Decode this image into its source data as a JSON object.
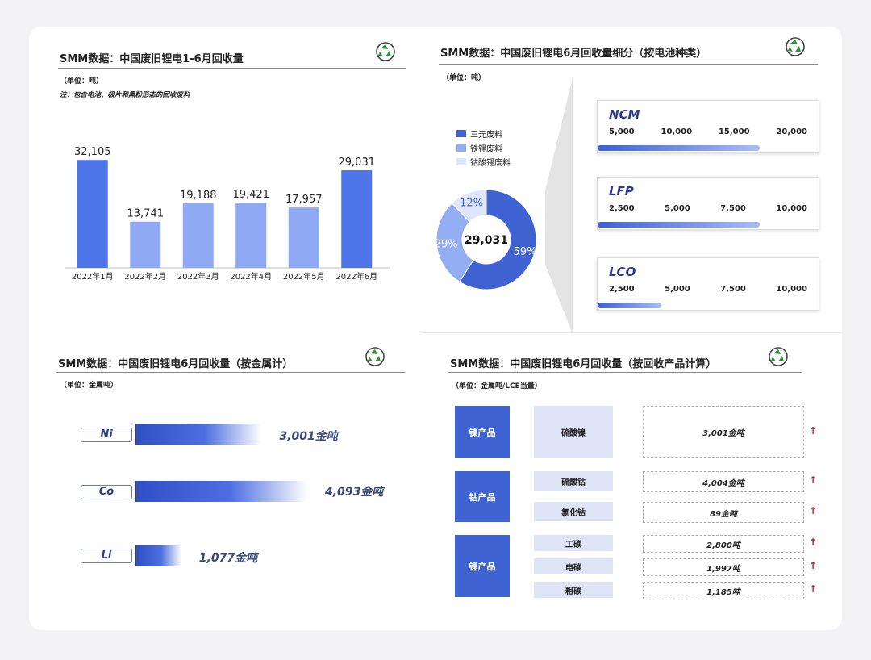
{
  "colors": {
    "accent": "#6f8ff0",
    "deep_blue": "#3f63d3",
    "mid_blue": "#93aef3",
    "light_blue": "#dfe6fb",
    "arrow_red": "#c0202a"
  },
  "panel1": {
    "title": "SMM数据：中国废旧锂电1-6月回收量",
    "unit": "（单位：吨）",
    "note": "注：包含电池、极片和黑粉形态的回收废料",
    "icon": "recycle-icon"
  },
  "panel2": {
    "title": "SMM数据：中国废旧锂电6月回收量细分（按电池种类）",
    "unit": "（单位：吨）",
    "icon": "recycle-icon",
    "center_total": "29,031",
    "legend": [
      "三元废料",
      "铁锂废料",
      "钴酸锂废料"
    ],
    "types": [
      {
        "name": "NCM",
        "ticks": [
          "5,000",
          "10,000",
          "15,000",
          "20,000"
        ],
        "level": 0.74
      },
      {
        "name": "LFP",
        "ticks": [
          "2,500",
          "5,000",
          "7,500",
          "10,000"
        ],
        "level": 0.74
      },
      {
        "name": "LCO",
        "ticks": [
          "2,500",
          "5,000",
          "7,500",
          "10,000"
        ],
        "level": 0.29
      }
    ]
  },
  "panel3": {
    "title": "SMM数据：中国废旧锂电6月回收量（按金属计）",
    "unit": "（单位：金属吨）",
    "icon": "recycle-icon",
    "metals": [
      {
        "name": "Ni",
        "value": "3,001金吨",
        "amount": 3001
      },
      {
        "name": "Co",
        "value": "4,093金吨",
        "amount": 4093
      },
      {
        "name": "Li",
        "value": "1,077金吨",
        "amount": 1077
      }
    ]
  },
  "panel4": {
    "title": "SMM数据：中国废旧锂电6月回收量（按回收产品计算）",
    "unit": "（单位：金属吨/LCE当量）",
    "icon": "recycle-icon",
    "groups": [
      {
        "label": "镍产品",
        "items": [
          {
            "name": "硫酸镍",
            "value": "3,001金吨"
          }
        ]
      },
      {
        "label": "钴产品",
        "items": [
          {
            "name": "硫酸钴",
            "value": "4,004金吨"
          },
          {
            "name": "氯化钴",
            "value": "89金吨"
          }
        ]
      },
      {
        "label": "锂产品",
        "items": [
          {
            "name": "工碳",
            "value": "2,800吨"
          },
          {
            "name": "电碳",
            "value": "1,997吨"
          },
          {
            "name": "粗碳",
            "value": "1,185吨"
          }
        ]
      }
    ],
    "arrow_icon": "arrow-up-icon"
  },
  "chart_data": [
    {
      "type": "bar",
      "categories": [
        "2022年1月",
        "2022年2月",
        "2022年3月",
        "2022年4月",
        "2022年5月",
        "2022年6月"
      ],
      "values": [
        32105,
        13741,
        19188,
        19421,
        17957,
        29031
      ],
      "value_labels": [
        "32,105",
        "13,741",
        "19,188",
        "19,421",
        "17,957",
        "29,031"
      ],
      "title": "SMM数据：中国废旧锂电1-6月回收量",
      "xlabel": "",
      "ylabel": "",
      "ylim": [
        0,
        36000
      ],
      "grid": false,
      "colors": [
        "#4d74e8",
        "#8fa9f5",
        "#8fa9f5",
        "#8fa9f5",
        "#8fa9f5",
        "#4d74e8"
      ]
    },
    {
      "type": "pie",
      "donut": true,
      "categories": [
        "三元废料",
        "铁锂废料",
        "钴酸锂废料"
      ],
      "values": [
        59,
        29,
        12
      ],
      "labels": [
        "59%",
        "29%",
        "12%"
      ],
      "center": "29,031",
      "colors": [
        "#3f63d3",
        "#93aef3",
        "#dfe6fb"
      ],
      "legend": "left"
    }
  ]
}
